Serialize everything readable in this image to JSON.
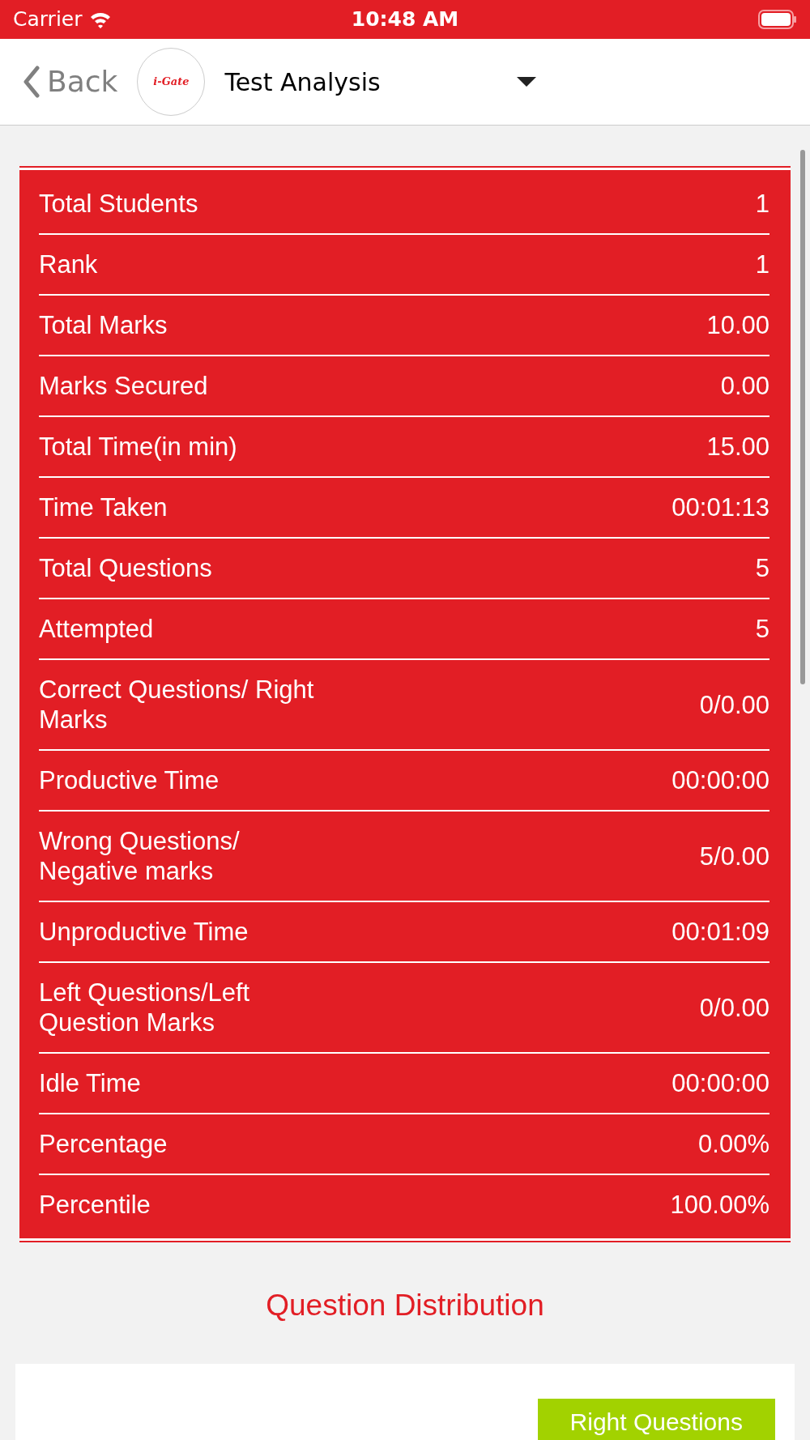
{
  "status_bar": {
    "carrier": "Carrier",
    "time": "10:48 AM"
  },
  "nav": {
    "back_label": "Back",
    "logo_text": "i-Gate",
    "title": "Test Analysis"
  },
  "stats": [
    {
      "label": "Total Students",
      "value": "1"
    },
    {
      "label": "Rank",
      "value": "1"
    },
    {
      "label": "Total Marks",
      "value": "10.00"
    },
    {
      "label": "Marks Secured",
      "value": "0.00"
    },
    {
      "label": "Total Time(in min)",
      "value": "15.00"
    },
    {
      "label": "Time Taken",
      "value": "00:01:13"
    },
    {
      "label": "Total Questions",
      "value": "5"
    },
    {
      "label": "Attempted",
      "value": "5"
    },
    {
      "label": "Correct Questions/ Right Marks",
      "value": "0/0.00"
    },
    {
      "label": "Productive Time",
      "value": "00:00:00"
    },
    {
      "label": "Wrong Questions/ Negative marks",
      "value": "5/0.00"
    },
    {
      "label": "Unproductive Time",
      "value": "00:01:09"
    },
    {
      "label": "Left Questions/Left Question Marks",
      "value": "0/0.00"
    },
    {
      "label": "Idle Time",
      "value": "00:00:00"
    },
    {
      "label": "Percentage",
      "value": "0.00%"
    },
    {
      "label": "Percentile",
      "value": "100.00%"
    }
  ],
  "section_title": "Question Distribution",
  "legend": [
    {
      "label": "Right Questions",
      "color": "#a2d200"
    }
  ]
}
